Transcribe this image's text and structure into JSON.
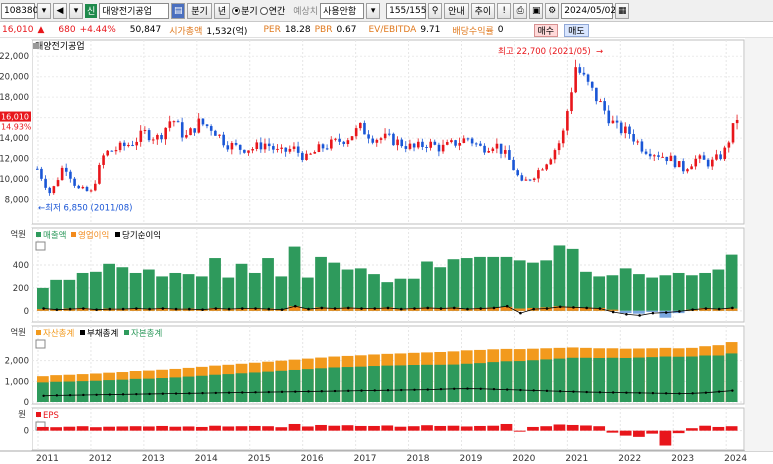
{
  "toolbar": {
    "code": "108380",
    "new_badge": "신",
    "stock_name": "대양전기공업",
    "quarter_btn": "분기",
    "year_btn": "년",
    "radio_quarter": "분기",
    "radio_year": "연간",
    "forecast_label": "예상치",
    "forecast_value": "사용안함",
    "page_count": "155/155",
    "guide_btn": "안내",
    "add_btn": "추이",
    "date": "2024/05/02"
  },
  "info": {
    "price": "16,010",
    "change": "680",
    "change_pct": "+4.44%",
    "volume": "50,847",
    "market_cap_label": "시가총액",
    "market_cap": "1,532(억)",
    "per_label": "PER",
    "per": "18.28",
    "pbr_label": "PBR",
    "pbr": "0.67",
    "ev_label": "EV/EBITDA",
    "ev": "9.71",
    "div_label": "배당수익률",
    "div": "0",
    "buy_btn": "매수",
    "sell_btn": "매도"
  },
  "colors": {
    "up": "#e8161b",
    "down": "#1a56d6",
    "revenue": "#2e9a5c",
    "op_income": "#f28a1d",
    "net_income": "#000000",
    "assets": "#f29a1d",
    "liabilities": "#2e9a5c",
    "eps": "#e8161b"
  },
  "price_panel": {
    "title": "대양전기공업",
    "current_label": "16,010",
    "current_pct": "14.93%",
    "high_note": "최고 22,700 (2021/05)",
    "low_note": "최저 6,850 (2011/08)",
    "y_ticks": [
      "22,000",
      "20,000",
      "18,000",
      "16,000",
      "14,000",
      "12,000",
      "10,000",
      "8,000"
    ]
  },
  "sales_panel": {
    "unit": "억원",
    "legend": [
      "매출액",
      "영업이익",
      "당기순이익"
    ],
    "y_ticks": [
      "400",
      "200",
      "0"
    ]
  },
  "balance_panel": {
    "unit": "억원",
    "legend": [
      "자산총계",
      "부채총계",
      "자본총계"
    ],
    "y_ticks": [
      "2,000",
      "1,000",
      "0"
    ]
  },
  "eps_panel": {
    "unit": "원",
    "legend": [
      "EPS"
    ],
    "y_ticks": [
      "0"
    ]
  },
  "x_axis": [
    "2011",
    "2012",
    "2013",
    "2014",
    "2015",
    "2016",
    "2017",
    "2018",
    "2019",
    "2020",
    "2021",
    "2022",
    "2023",
    "2024"
  ],
  "chart_data": [
    {
      "type": "line",
      "title": "대양전기공업",
      "x": [
        "2011/06",
        "2011/09",
        "2011/12",
        "2012/03",
        "2012/06",
        "2012/09",
        "2012/12",
        "2013/03",
        "2013/06",
        "2013/09",
        "2013/12",
        "2014/03",
        "2014/06",
        "2014/09",
        "2014/12",
        "2015/03",
        "2015/06",
        "2015/09",
        "2015/12",
        "2016/03",
        "2016/06",
        "2016/09",
        "2016/12",
        "2017/03",
        "2017/06",
        "2017/09",
        "2017/12",
        "2018/03",
        "2018/06",
        "2018/09",
        "2018/12",
        "2019/03",
        "2019/06",
        "2019/09",
        "2019/12",
        "2020/03",
        "2020/06",
        "2020/09",
        "2020/12",
        "2021/03",
        "2021/06",
        "2021/09",
        "2021/12",
        "2022/03",
        "2022/06",
        "2022/09",
        "2022/12",
        "2023/03",
        "2023/06",
        "2023/09",
        "2023/12",
        "2024/03",
        "2024/05"
      ],
      "values": [
        11000,
        8500,
        11500,
        9000,
        8700,
        12500,
        13000,
        13500,
        14500,
        14000,
        16000,
        14000,
        15500,
        15000,
        13500,
        13000,
        13000,
        13500,
        12500,
        13000,
        12000,
        13000,
        13500,
        14000,
        15000,
        14000,
        14000,
        13500,
        13000,
        13500,
        13000,
        13500,
        14000,
        13000,
        13500,
        12000,
        9500,
        10500,
        12000,
        14000,
        21000,
        19000,
        17000,
        15000,
        14500,
        13000,
        12500,
        12000,
        11000,
        12000,
        11500,
        12500,
        16010
      ],
      "ylim": [
        6000,
        23000
      ]
    },
    {
      "type": "bar",
      "series": [
        {
          "name": "매출액",
          "values": [
            200,
            270,
            270,
            330,
            340,
            410,
            380,
            330,
            360,
            300,
            330,
            320,
            300,
            460,
            290,
            410,
            330,
            460,
            300,
            560,
            290,
            470,
            420,
            360,
            370,
            320,
            250,
            280,
            280,
            430,
            380,
            450,
            460,
            470,
            470,
            470,
            440,
            420,
            440,
            570,
            540,
            340,
            300,
            310,
            370,
            320,
            290,
            310,
            330,
            310,
            330,
            360,
            490
          ]
        },
        {
          "name": "영업이익",
          "values": [
            15,
            12,
            20,
            25,
            15,
            20,
            18,
            22,
            20,
            25,
            18,
            20,
            15,
            25,
            20,
            22,
            25,
            20,
            15,
            40,
            20,
            30,
            25,
            30,
            25,
            25,
            30,
            20,
            25,
            30,
            25,
            30,
            20,
            25,
            30,
            35,
            20,
            25,
            30,
            40,
            35,
            30,
            25,
            10,
            -20,
            -25,
            -10,
            -60,
            -20,
            10,
            25,
            20,
            20
          ]
        },
        {
          "name": "당기순이익",
          "values": [
            20,
            10,
            15,
            20,
            10,
            15,
            15,
            20,
            15,
            20,
            15,
            15,
            10,
            20,
            15,
            20,
            20,
            15,
            10,
            40,
            15,
            25,
            20,
            25,
            20,
            20,
            25,
            15,
            20,
            25,
            20,
            25,
            15,
            20,
            25,
            40,
            -20,
            15,
            20,
            35,
            30,
            25,
            20,
            -10,
            -30,
            -40,
            -20,
            -15,
            -5,
            10,
            20,
            15,
            25
          ]
        }
      ],
      "ylim": [
        -80,
        600
      ]
    },
    {
      "type": "bar",
      "series": [
        {
          "name": "자산총계",
          "values": [
            1250,
            1300,
            1320,
            1350,
            1380,
            1420,
            1450,
            1500,
            1520,
            1560,
            1600,
            1650,
            1700,
            1760,
            1800,
            1850,
            1900,
            1950,
            2000,
            2050,
            2100,
            2150,
            2200,
            2230,
            2260,
            2300,
            2330,
            2350,
            2380,
            2400,
            2420,
            2450,
            2500,
            2520,
            2550,
            2570,
            2560,
            2580,
            2600,
            2620,
            2640,
            2620,
            2600,
            2600,
            2580,
            2590,
            2600,
            2620,
            2600,
            2620,
            2700,
            2750,
            2900
          ]
        },
        {
          "name": "부채총계",
          "values": [
            300,
            320,
            330,
            340,
            350,
            360,
            370,
            380,
            390,
            400,
            410,
            420,
            430,
            440,
            450,
            460,
            470,
            480,
            490,
            500,
            510,
            520,
            530,
            540,
            550,
            560,
            570,
            580,
            590,
            600,
            620,
            640,
            650,
            640,
            620,
            600,
            580,
            560,
            540,
            520,
            500,
            480,
            470,
            460,
            450,
            440,
            430,
            420,
            410,
            420,
            450,
            500,
            550
          ]
        },
        {
          "name": "자본총계",
          "values": [
            950,
            980,
            990,
            1010,
            1030,
            1060,
            1080,
            1120,
            1130,
            1160,
            1190,
            1230,
            1270,
            1320,
            1350,
            1390,
            1430,
            1470,
            1510,
            1550,
            1590,
            1630,
            1670,
            1690,
            1710,
            1740,
            1760,
            1770,
            1790,
            1800,
            1800,
            1810,
            1850,
            1880,
            1930,
            1970,
            1980,
            2020,
            2060,
            2100,
            2140,
            2140,
            2130,
            2140,
            2130,
            2150,
            2170,
            2200,
            2190,
            2200,
            2250,
            2250,
            2350
          ]
        }
      ],
      "ylim": [
        0,
        3000
      ]
    },
    {
      "type": "bar",
      "series": [
        {
          "name": "EPS",
          "values": [
            150,
            140,
            160,
            180,
            140,
            160,
            170,
            180,
            170,
            190,
            160,
            170,
            150,
            200,
            170,
            180,
            190,
            180,
            140,
            270,
            170,
            230,
            200,
            220,
            190,
            190,
            210,
            160,
            180,
            220,
            190,
            200,
            170,
            190,
            200,
            270,
            -40,
            150,
            180,
            250,
            230,
            210,
            180,
            -80,
            -200,
            -250,
            -120,
            -600,
            -100,
            100,
            200,
            150,
            180
          ]
        }
      ],
      "ylim": [
        -700,
        350
      ]
    }
  ]
}
